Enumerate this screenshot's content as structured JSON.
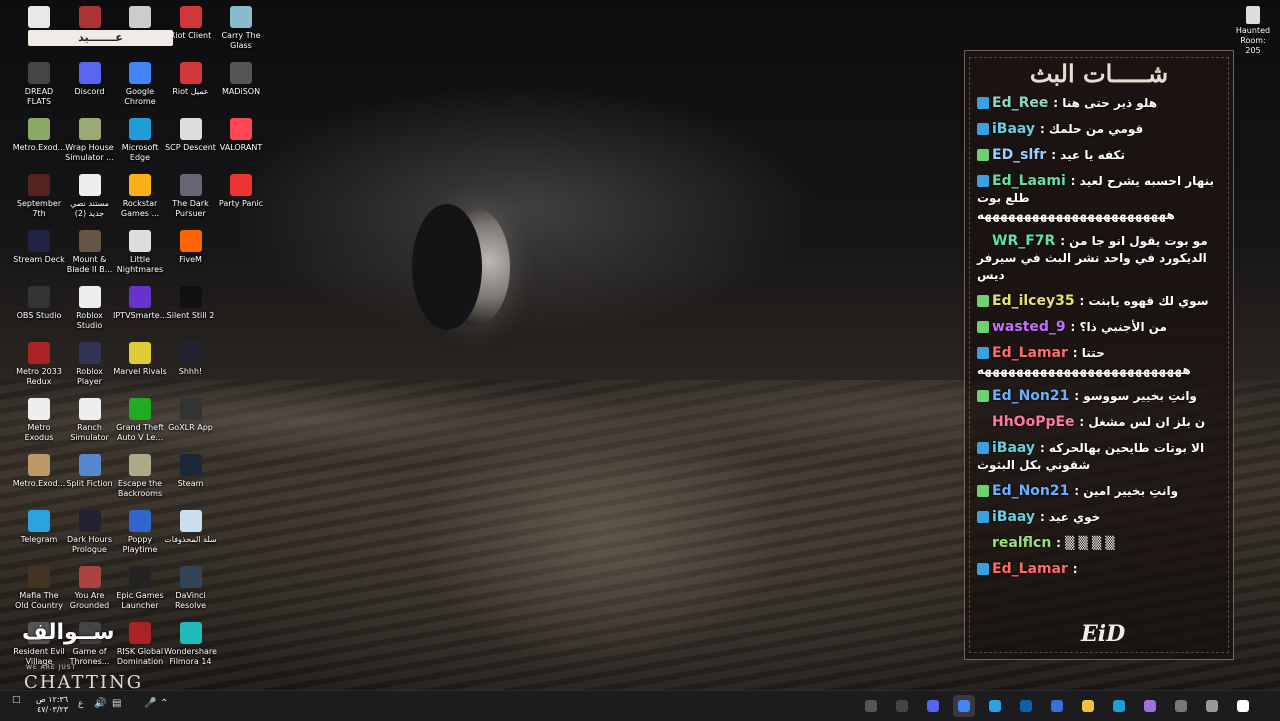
{
  "desktop": {
    "icons": [
      {
        "label": "",
        "color": "#e8e8e8"
      },
      {
        "label": "",
        "color": "#a33"
      },
      {
        "label": "",
        "color": "#ccc"
      },
      {
        "label": "Riot Client",
        "color": "#d13639"
      },
      {
        "label": "Carry The Glass",
        "color": "#8bc"
      },
      {
        "label": "DREAD FLATS",
        "color": "#444"
      },
      {
        "label": "Discord",
        "color": "#5865f2"
      },
      {
        "label": "Google Chrome",
        "color": "#4285f4"
      },
      {
        "label": "Riot عميل",
        "color": "#d13639"
      },
      {
        "label": "MADiSON",
        "color": "#555"
      },
      {
        "label": "Metro.Exod...",
        "color": "#8a6"
      },
      {
        "label": "Wrap House Simulator ...",
        "color": "#9a7"
      },
      {
        "label": "Microsoft Edge",
        "color": "#1c9fd8"
      },
      {
        "label": "SCP Descent",
        "color": "#ddd"
      },
      {
        "label": "VALORANT",
        "color": "#ff4655"
      },
      {
        "label": "September 7th",
        "color": "#522"
      },
      {
        "label": "مستند نصي جديد (2)",
        "color": "#eee"
      },
      {
        "label": "Rockstar Games ...",
        "color": "#fcaf17"
      },
      {
        "label": "The Dark Pursuer",
        "color": "#667"
      },
      {
        "label": "Party Panic",
        "color": "#e33"
      },
      {
        "label": "Stream Deck",
        "color": "#224"
      },
      {
        "label": "Mount & Blade II B...",
        "color": "#654"
      },
      {
        "label": "Little Nightmares",
        "color": "#ddd"
      },
      {
        "label": "FiveM",
        "color": "#f60"
      },
      {
        "label": "",
        "color": "transparent"
      },
      {
        "label": "OBS Studio",
        "color": "#333"
      },
      {
        "label": "Roblox Studio",
        "color": "#eee"
      },
      {
        "label": "IPTVSmarte...",
        "color": "#63c"
      },
      {
        "label": "Silent Still 2",
        "color": "#111"
      },
      {
        "label": "",
        "color": "transparent"
      },
      {
        "label": "Metro 2033 Redux",
        "color": "#a22"
      },
      {
        "label": "Roblox Player",
        "color": "#335"
      },
      {
        "label": "Marvel Rivals",
        "color": "#dc3"
      },
      {
        "label": "Shhh!",
        "color": "#223"
      },
      {
        "label": "",
        "color": "transparent"
      },
      {
        "label": "Metro Exodus",
        "color": "#eee"
      },
      {
        "label": "Ranch Simulator",
        "color": "#eee"
      },
      {
        "label": "Grand Theft Auto V Le...",
        "color": "#2a2"
      },
      {
        "label": "GoXLR App",
        "color": "#333"
      },
      {
        "label": "",
        "color": "transparent"
      },
      {
        "label": "Metro.Exod...",
        "color": "#b96"
      },
      {
        "label": "Split Fiction",
        "color": "#58c"
      },
      {
        "label": "Escape the Backrooms",
        "color": "#aa8"
      },
      {
        "label": "Steam",
        "color": "#1b2838"
      },
      {
        "label": "",
        "color": "transparent"
      },
      {
        "label": "Telegram",
        "color": "#2aa3e0"
      },
      {
        "label": "Dark Hours Prologue",
        "color": "#223"
      },
      {
        "label": "Poppy Playtime",
        "color": "#36c"
      },
      {
        "label": "سلة المحذوفات",
        "color": "#cde"
      },
      {
        "label": "",
        "color": "transparent"
      },
      {
        "label": "Mafia The Old Country",
        "color": "#432"
      },
      {
        "label": "You Are Grounded",
        "color": "#a44"
      },
      {
        "label": "Epic Games Launcher",
        "color": "#222"
      },
      {
        "label": "DaVinci Resolve",
        "color": "#345"
      },
      {
        "label": "",
        "color": "transparent"
      },
      {
        "label": "Resident Evil Village",
        "color": "#555"
      },
      {
        "label": "Game of Thrones...",
        "color": "#444"
      },
      {
        "label": "RISK Global Domination",
        "color": "#a22"
      },
      {
        "label": "Wondershare Filmora 14",
        "color": "#2bb"
      }
    ],
    "haunted_label": "Haunted Room: 205",
    "top_brand": "عـــــــيد",
    "brand_ar": "ســوالف",
    "brand_small": "WE ARE JUST",
    "brand_big": "CHATTING"
  },
  "chat": {
    "title": "شـــــات البث",
    "logo": "EiD",
    "messages": [
      {
        "user": "Ed_Ree",
        "user_color": "#8fd6c0",
        "badge": "#3aa0e0",
        "text": ": هلو ذير حتى هنا"
      },
      {
        "user": "iBaay",
        "user_color": "#6ad0e0",
        "badge": "#3aa0e0",
        "text": ": قومي من حلمك"
      },
      {
        "user": "ED_slfr",
        "user_color": "#9ad0ff",
        "badge": "#6fd06f",
        "text": ": تكفه يا عيد"
      },
      {
        "user": "Ed_Laami",
        "user_color": "#66e0a0",
        "badge": "#3aa0e0",
        "text": ": بنهار احسبه يشرح لعيد طلع بوت ههههههههههههههههههههههههه"
      },
      {
        "user": "WR_F7R",
        "user_color": "#66e0a0",
        "badge": "transparent",
        "text": ": مو بوت يقول انو جا من الديكورد في واحد نشر البث في سيرفر ديس"
      },
      {
        "user": "Ed_ilcey35",
        "user_color": "#e8e070",
        "badge": "#6fd06f",
        "text": ": سوي لك قهوه يابنت"
      },
      {
        "user": "wasted_9",
        "user_color": "#c070ff",
        "badge": "#6fd06f",
        "text": ": من الأجنبي ذا؟"
      },
      {
        "user": "Ed_Lamar",
        "user_color": "#ff6a6a",
        "badge": "#3aa0e0",
        "text": ": حتتا ههههههههههههههههههههههههههه"
      },
      {
        "user": "Ed_Non21",
        "user_color": "#6ab0ff",
        "badge": "#6fd06f",
        "text": ": وانتِ بخيير سووسو"
      },
      {
        "user": "HhOoPpEe",
        "user_color": "#ff7aa0",
        "badge": "transparent",
        "text": ": ن بلز ان لس مشغل"
      },
      {
        "user": "iBaay",
        "user_color": "#6ad0e0",
        "badge": "#3aa0e0",
        "text": ": الا بوتات طايحين بهالحركه شقوني بكل البثوث"
      },
      {
        "user": "Ed_Non21",
        "user_color": "#6ab0ff",
        "badge": "#6fd06f",
        "text": ": وانتِ بخيير امين"
      },
      {
        "user": "iBaay",
        "user_color": "#6ad0e0",
        "badge": "#3aa0e0",
        "text": ": خوي عيد"
      },
      {
        "user": "realflcn",
        "user_color": "#9ae07a",
        "badge": "transparent",
        "text": ": ▒ ▒ ▒ ▒"
      },
      {
        "user": "Ed_Lamar",
        "user_color": "#ff6a6a",
        "badge": "#3aa0e0",
        "text": ":"
      }
    ]
  },
  "taskbar": {
    "clock_time": "١٢:٣٦ ص",
    "clock_date": "٤٧/٠٣/٢٣",
    "lang": "ع",
    "apps": [
      "snip",
      "obs",
      "discord",
      "chrome",
      "telegram",
      "outlook",
      "store",
      "explorer",
      "edge",
      "copilot",
      "taskview",
      "search",
      "start"
    ]
  }
}
